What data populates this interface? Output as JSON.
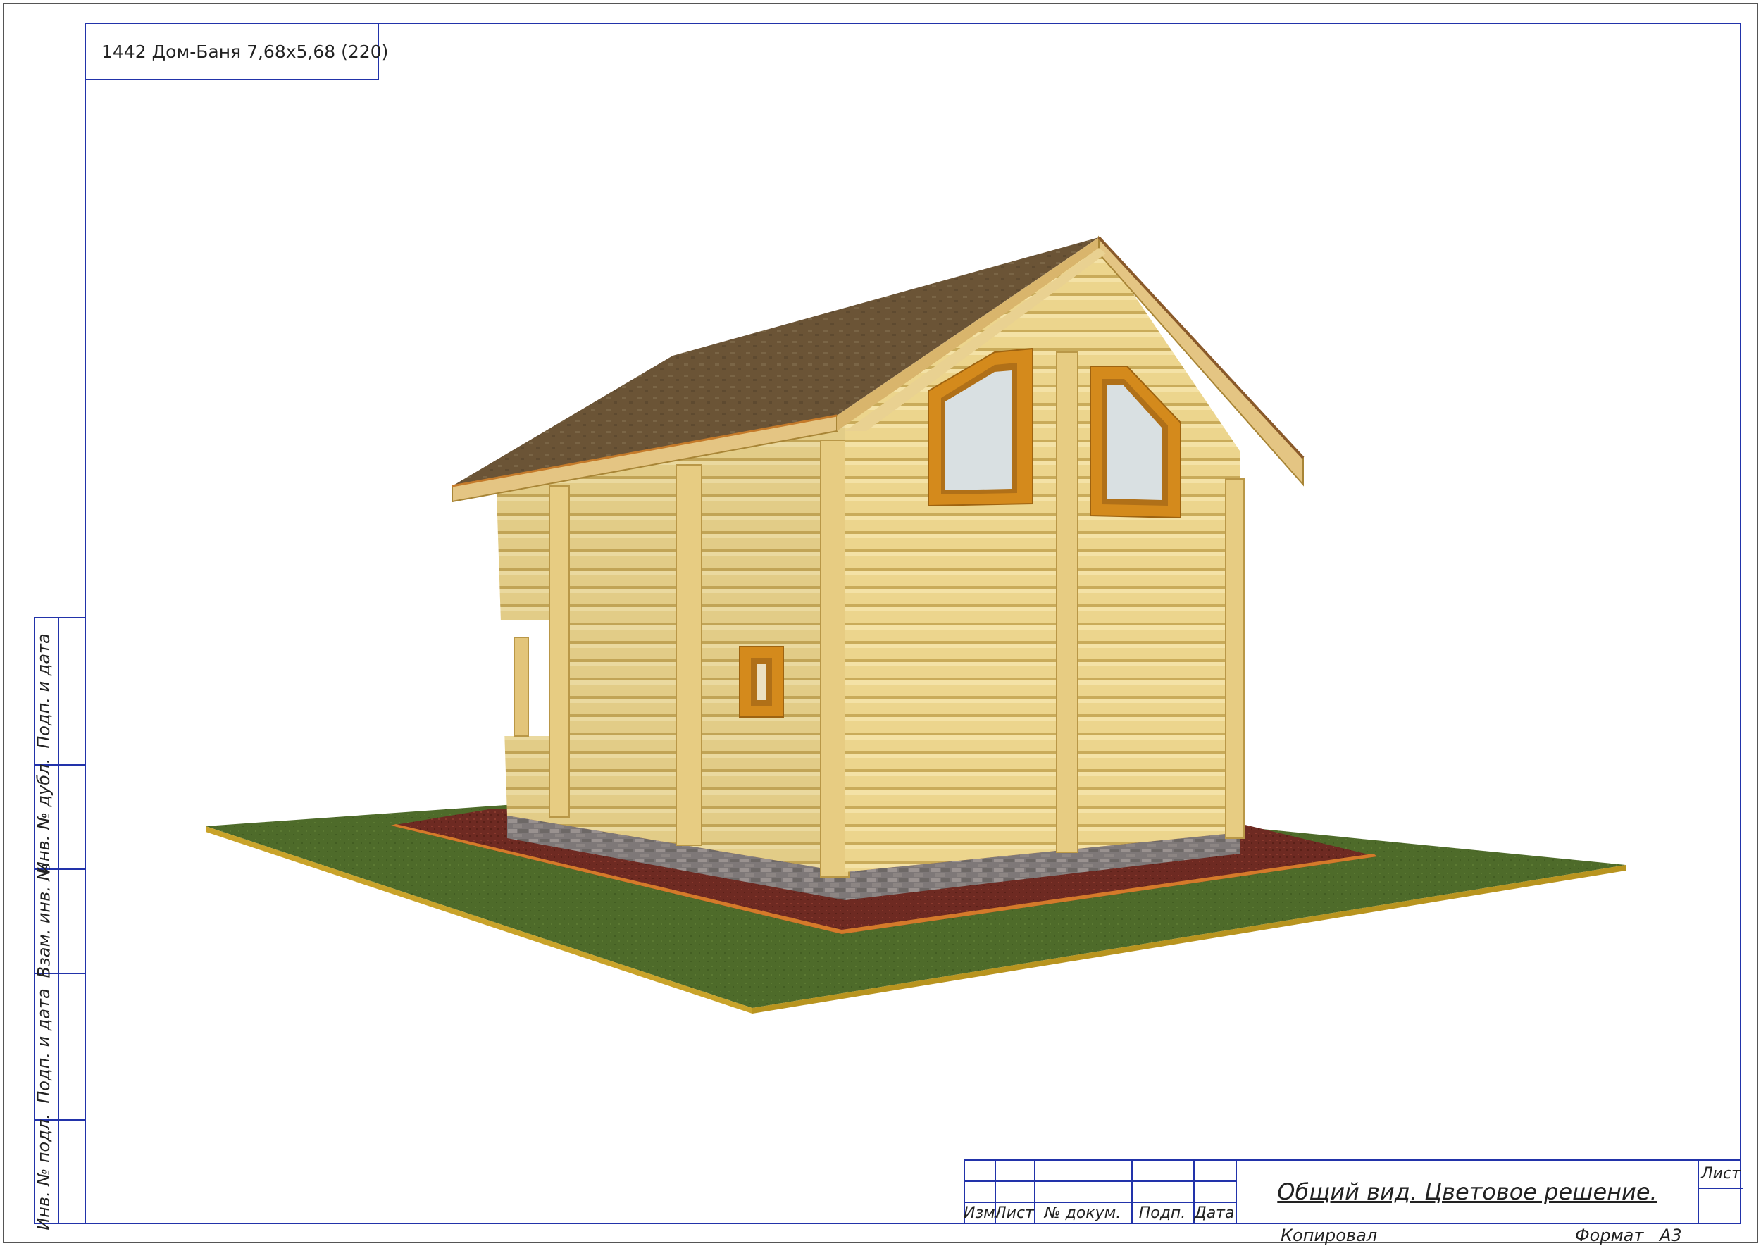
{
  "sheet": {
    "title": "1442 Дом-Баня 7,68х5,68 (220)",
    "drawing_name": "Общий вид. Цветовое решение.",
    "sheet_label": "Лист",
    "copied_label": "Копировал",
    "format_label": "Формат",
    "format_value": "А3"
  },
  "side_stamp": [
    "Подп. и дата",
    "Инв. № дубл.",
    "Взам. инв. №",
    "Подп. и дата",
    "Инв. № подл."
  ],
  "title_block_headers": [
    "Изм.",
    "Лист",
    "№ докум.",
    "Подп.",
    "Дата"
  ],
  "colors": {
    "frame": "#2233aa",
    "log_wall": "#e8cf86",
    "roof": "#6b5436",
    "trim": "#d48a1c",
    "grass": "#4e6b2a",
    "path": "#6e2a22",
    "plinth": "#7a7474"
  }
}
